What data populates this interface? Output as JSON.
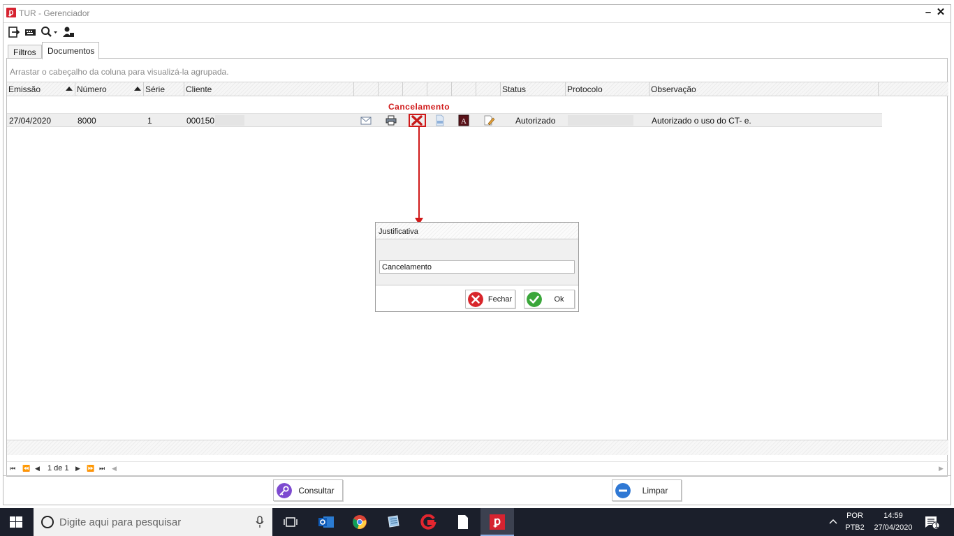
{
  "window": {
    "title": "TUR - Gerenciador",
    "minimize": "–",
    "close": "✕"
  },
  "toolbar": {
    "icons": [
      "exit-icon",
      "keyboard-icon",
      "search-dropdown-icon",
      "user-icon"
    ]
  },
  "tabs": [
    {
      "label": "Filtros",
      "active": false
    },
    {
      "label": "Documentos",
      "active": true
    }
  ],
  "grid": {
    "group_hint": "Arrastar o cabeçalho da coluna para visualizá-la agrupada.",
    "columns": [
      "Emissão",
      "Número",
      "Série",
      "Cliente",
      "",
      "",
      "",
      "",
      "",
      "",
      "Status",
      "Protocolo",
      "Observação"
    ],
    "rows": [
      {
        "emissao": "27/04/2020",
        "numero": "8000",
        "serie": "1",
        "cliente": "000150",
        "status": "Autorizado",
        "protocolo": "",
        "observacao": "Autorizado o uso do CT- e.",
        "actions": [
          "email-icon",
          "print-icon",
          "cancel-icon",
          "document-icon",
          "pdf-icon",
          "edit-icon"
        ]
      }
    ]
  },
  "annotation": {
    "label": "Cancelamento",
    "color": "#d01a1a"
  },
  "pager": {
    "text": "1 de 1"
  },
  "buttons": {
    "consultar": "Consultar",
    "limpar": "Limpar"
  },
  "dialog": {
    "title": "Justificativa",
    "input_value": "Cancelamento",
    "fechar": "Fechar",
    "ok": "Ok"
  },
  "taskbar": {
    "search_placeholder": "Digite aqui para pesquisar",
    "lang_top": "POR",
    "lang_bottom": "PTB2",
    "time": "14:59",
    "date": "27/04/2020",
    "notification_count": "1"
  },
  "colors": {
    "accent_red": "#d62330",
    "taskbar": "#1b1f2b"
  }
}
